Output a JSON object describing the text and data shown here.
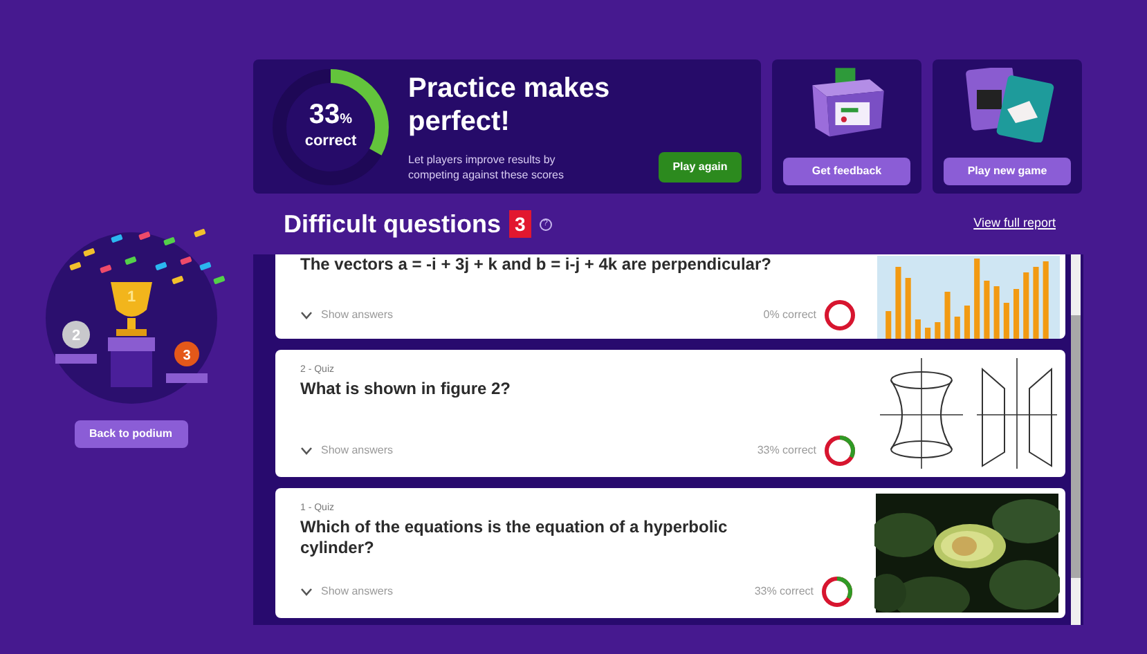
{
  "score": {
    "value": "33",
    "unit": "%",
    "label": "correct",
    "level": 0.33,
    "title": "Practice makes perfect!",
    "text": "Let players improve results by competing against these scores",
    "button": "Play again"
  },
  "actions": [
    {
      "kind": "feedback",
      "button": "Get feedback"
    },
    {
      "kind": "newgame",
      "button": "Play new game"
    }
  ],
  "podium": {
    "places": [
      "2",
      "1",
      "3"
    ],
    "button": "Back to podium"
  },
  "difficult": {
    "title": "Difficult questions",
    "count": "3",
    "help": "?",
    "link": "View full report"
  },
  "questions": [
    {
      "kind": "bars",
      "question": "The vectors a = -i + 3j + k and b = i-j + 4k are perpendicular?",
      "toggle": "Show answers",
      "percent": "0% correct",
      "level": 0
    },
    {
      "kind": "figure",
      "label": "2 - Quiz",
      "question": "What is shown in figure 2?",
      "toggle": "Show answers",
      "percent": "33% correct",
      "level": 0.33
    },
    {
      "label": "1 - Quiz",
      "question": "Which of the equations is the equation of a hyperbolic cylinder?",
      "toggle": "Show answers",
      "percent": "33% correct",
      "level": 0.33
    }
  ]
}
